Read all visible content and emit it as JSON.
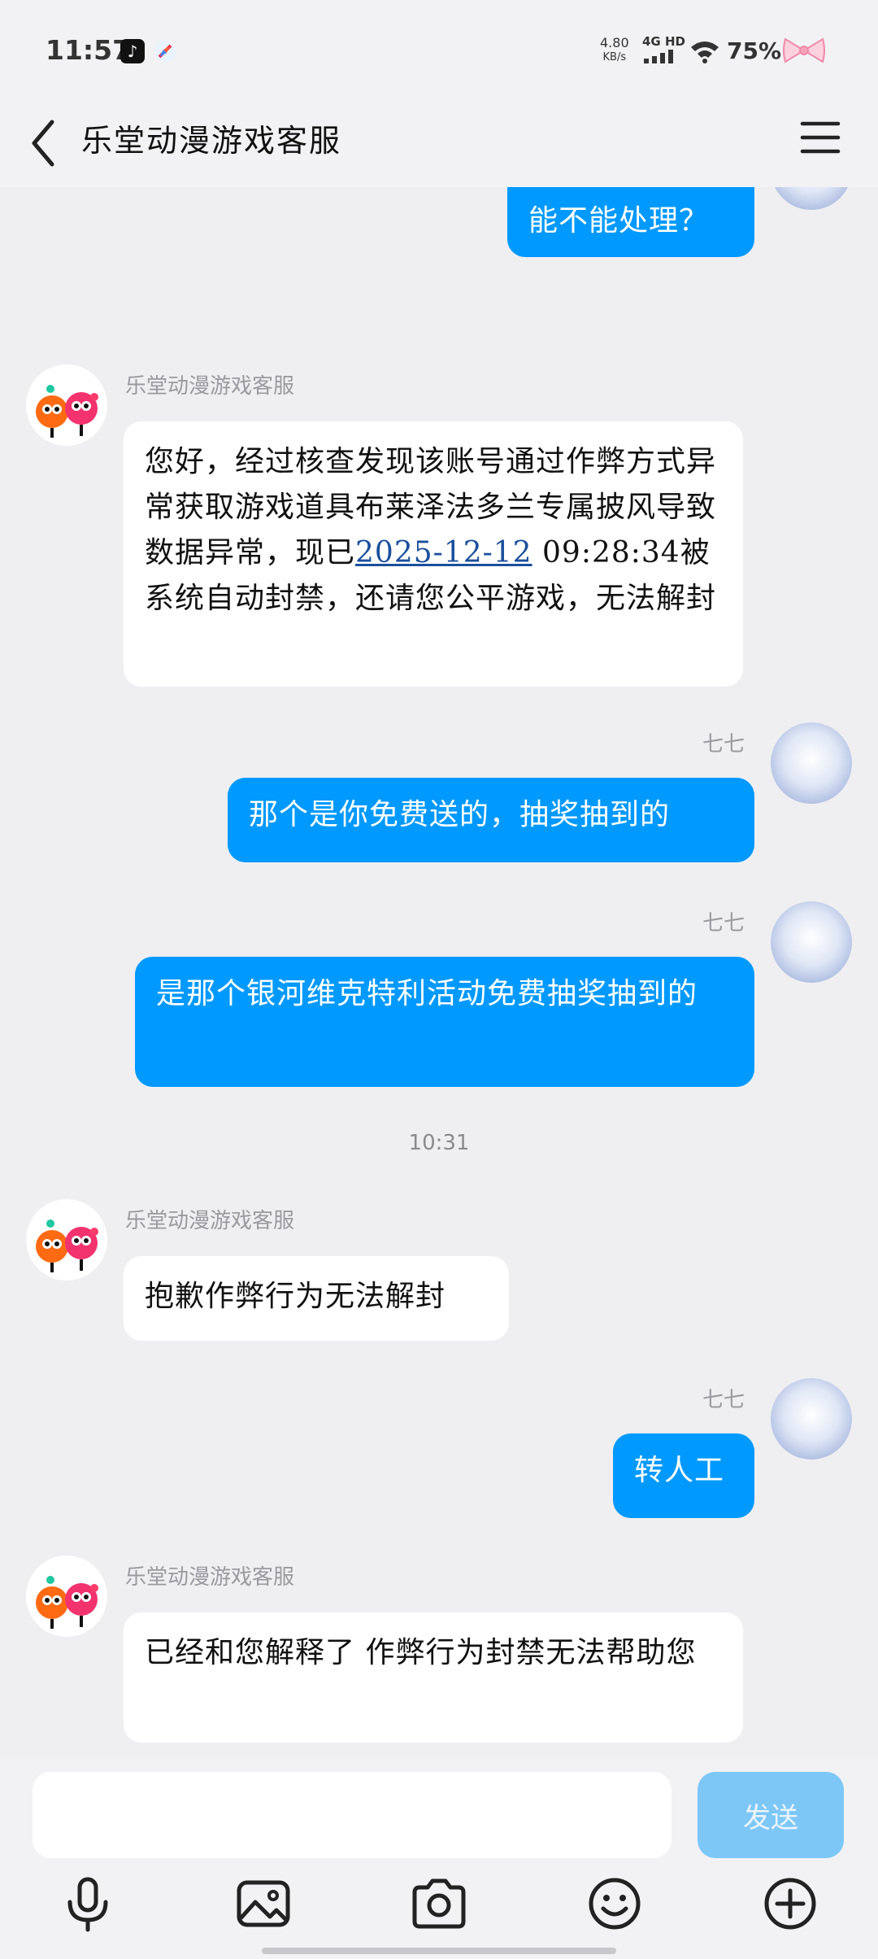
{
  "status_bar": {
    "time": "11:57",
    "net_speed_value": "4.80",
    "net_speed_unit": "KB/s",
    "net_type": "4G HD",
    "battery": "75%"
  },
  "header": {
    "title": "乐堂动漫游戏客服",
    "back_icon": "chevron-left-icon",
    "menu_icon": "hamburger-menu-icon"
  },
  "chat": {
    "bot_name": "乐堂动漫游戏客服",
    "user_name": "七七",
    "messages": [
      {
        "side": "right",
        "text": "能不能处理？"
      },
      {
        "side": "left",
        "text_before": "您好，经过核查发现该账号通过作弊方式异常获取游戏道具布莱泽法多兰专属披风导致数据异常，现已",
        "date": "2025-12-12",
        "text_after": " 09:28:34被系统自动封禁，还请您公平游戏，无法解封"
      },
      {
        "side": "right",
        "text": "那个是你免费送的，抽奖抽到的"
      },
      {
        "side": "right",
        "text": "是那个银河维克特利活动免费抽奖抽到的"
      },
      {
        "side": "left",
        "text": "抱歉作弊行为无法解封"
      },
      {
        "side": "right",
        "text": "转人工"
      },
      {
        "side": "left",
        "text": "已经和您解释了 作弊行为封禁无法帮助您"
      }
    ],
    "timestamp": "10:31"
  },
  "input": {
    "placeholder": "",
    "send_label": "发送"
  },
  "toolbar": {
    "icons": [
      "microphone-icon",
      "image-icon",
      "camera-icon",
      "emoji-icon",
      "plus-icon"
    ]
  },
  "colors": {
    "accent": "#0099ff",
    "send_disabled": "#7dc7f7",
    "background": "#efeff2"
  }
}
